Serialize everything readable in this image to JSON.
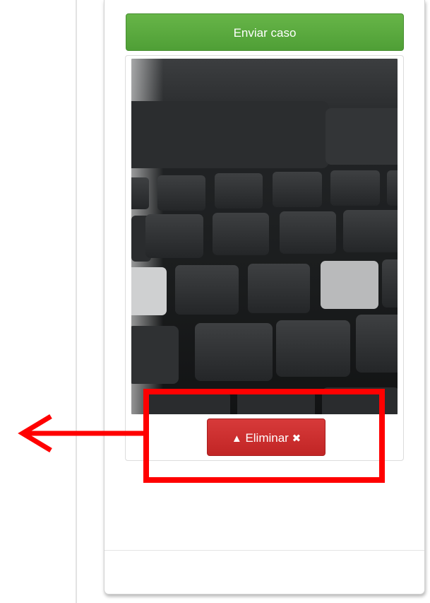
{
  "form": {
    "send_button": "Enviar caso"
  },
  "attachment": {
    "delete_button": "Eliminar",
    "delete_lead_icon": "chevron-up-icon",
    "delete_trail_icon": "close-icon"
  },
  "colors": {
    "send": "#5cac3f",
    "delete": "#cc2a2a",
    "annotation": "#ff0000"
  }
}
